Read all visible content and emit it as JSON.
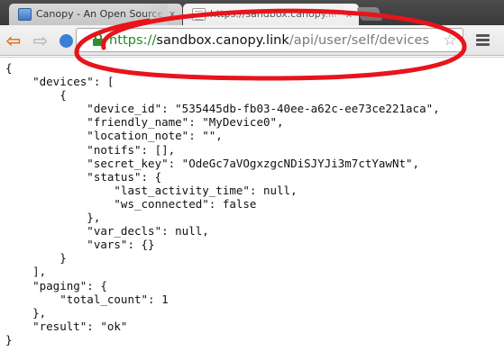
{
  "browser": {
    "tabs": [
      {
        "title": "Canopy - An Open Source",
        "close": "x"
      },
      {
        "title": "https://sandbox.canopy.lin",
        "close": "x"
      }
    ],
    "address_bar": {
      "scheme": "https://",
      "host": "sandbox.canopy.link",
      "path": "/api/user/self/devices"
    },
    "icons": {
      "back": "back-arrow-icon",
      "forward": "forward-arrow-icon",
      "reload": "reload-icon",
      "lock": "lock-icon",
      "bookmark": "star-icon",
      "menu": "hamburger-menu-icon"
    },
    "colors": {
      "accent_back": "#e06b1a",
      "secure": "#1b8c1b",
      "annotation": "#e8141b"
    }
  },
  "json_lines": [
    "{",
    "    \"devices\": [",
    "        {",
    "            \"device_id\": \"535445db-fb03-40ee-a62c-ee73ce221aca\",",
    "            \"friendly_name\": \"MyDevice0\",",
    "            \"location_note\": \"\",",
    "            \"notifs\": [],",
    "            \"secret_key\": \"OdeGc7aVOgxzgcNDiSJYJi3m7ctYawNt\",",
    "            \"status\": {",
    "                \"last_activity_time\": null,",
    "                \"ws_connected\": false",
    "            },",
    "            \"var_decls\": null,",
    "            \"vars\": {}",
    "        }",
    "    ],",
    "    \"paging\": {",
    "        \"total_count\": 1",
    "    },",
    "    \"result\": \"ok\"",
    "}"
  ]
}
